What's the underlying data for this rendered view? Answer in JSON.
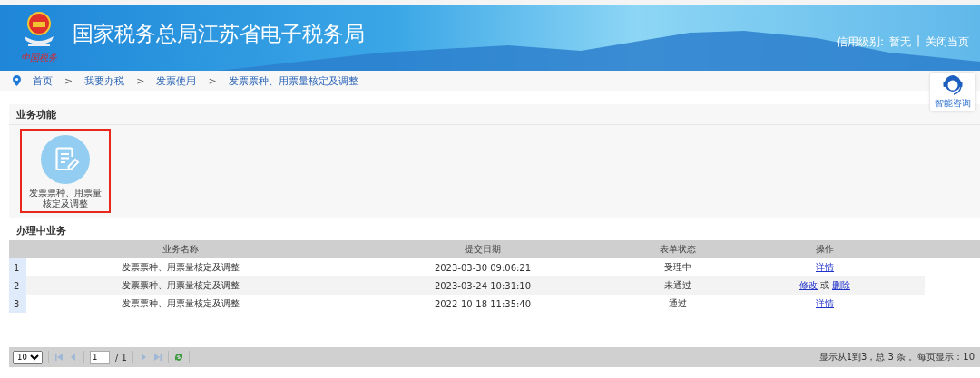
{
  "header": {
    "logo_caption": "中国税务",
    "title": "国家税务总局江苏省电子税务局",
    "credit_label": "信用级别:",
    "credit_value": "暂无",
    "separator": "|",
    "close_link": "关闭当页"
  },
  "breadcrumb": [
    "首页",
    "我要办税",
    "发票使用",
    "发票票种、用票量核定及调整"
  ],
  "breadcrumb_separator": ">",
  "help_button": {
    "label": "智能咨询"
  },
  "functions": {
    "title": "业务功能",
    "items": [
      {
        "label": "发票票种、用票量核定及调整",
        "selected": true
      }
    ]
  },
  "tasks": {
    "title": "办理中业务",
    "columns": [
      "业务名称",
      "提交日期",
      "表单状态",
      "操作"
    ],
    "rows": [
      {
        "index": "1",
        "name": "发票票种、用票量核定及调整",
        "date": "2023-03-30 09:06:21",
        "status": "受理中",
        "actions": [
          {
            "kind": "link",
            "text": "详情"
          }
        ]
      },
      {
        "index": "2",
        "name": "发票票种、用票量核定及调整",
        "date": "2023-03-24 10:31:10",
        "status": "未通过",
        "actions": [
          {
            "kind": "link",
            "text": "修改"
          },
          {
            "kind": "text",
            "text": "或"
          },
          {
            "kind": "link",
            "text": "删除"
          }
        ]
      },
      {
        "index": "3",
        "name": "发票票种、用票量核定及调整",
        "date": "2022-10-18 11:35:40",
        "status": "通过",
        "actions": [
          {
            "kind": "link",
            "text": "详情"
          }
        ]
      }
    ]
  },
  "pager": {
    "page_size": "10",
    "page": "1",
    "total_pages": "/ 1",
    "summary": "显示从1到3，总 3 条 。每页显示：10"
  }
}
